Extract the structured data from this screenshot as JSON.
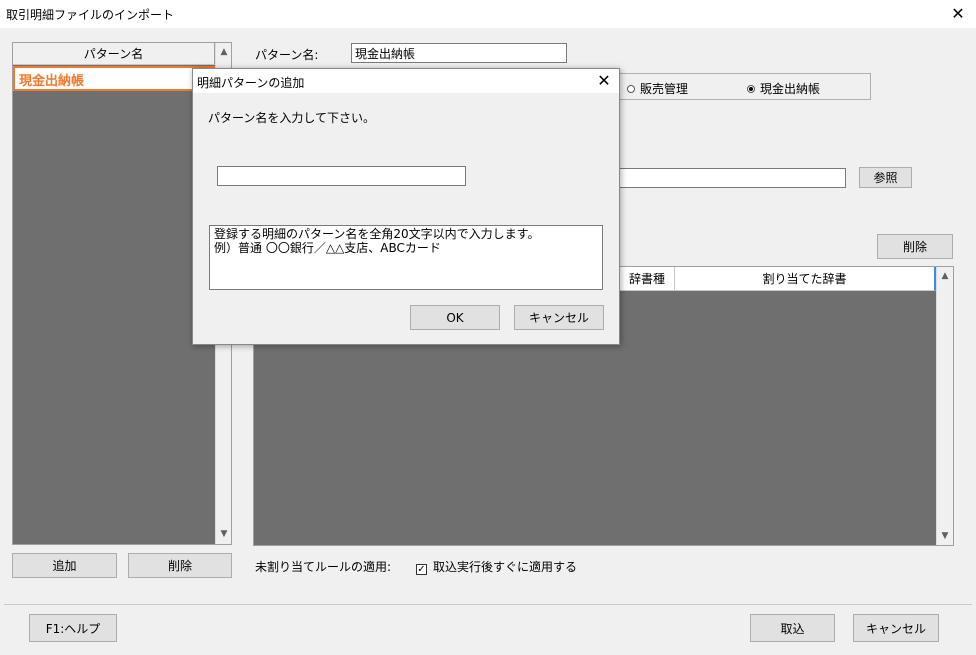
{
  "window": {
    "title": "取引明細ファイルのインポート",
    "close": "✕"
  },
  "left_panel": {
    "header": "パターン名",
    "items": [
      "現金出納帳"
    ],
    "add_label": "追加",
    "delete_label": "削除"
  },
  "right_panel": {
    "pattern_name_label": "パターン名:",
    "pattern_name_value": "現金出納帳",
    "radio_sales": "販売管理",
    "radio_cash": "現金出納帳",
    "browse_label": "参照",
    "delete_label": "削除",
    "grid_cols": [
      "辞書種",
      "割り当てた辞書"
    ],
    "unassigned_label": "未割り当てルールの適用:",
    "apply_checkbox_label": "取込実行後すぐに適用する"
  },
  "footer": {
    "help_label": "F1:ヘルプ",
    "import_label": "取込",
    "cancel_label": "キャンセル"
  },
  "dialog": {
    "title": "明細パターンの追加",
    "close": "✕",
    "prompt": "パターン名を入力して下さい。",
    "input_value": "",
    "note_line1": "登録する明細のパターン名を全角20文字以内で入力します。",
    "note_line2": "例）普通 〇〇銀行／△△支店、ABCカード",
    "ok_label": "OK",
    "cancel_label": "キャンセル"
  }
}
